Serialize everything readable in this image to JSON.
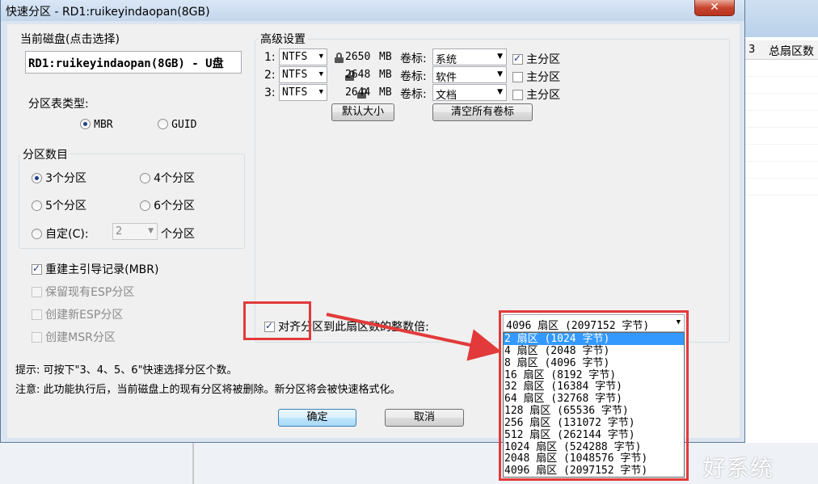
{
  "background_app": {
    "column_number": "3",
    "column_total_sectors": "总扇区数"
  },
  "dialog": {
    "title": "快速分区 - RD1:ruikeyindaopan(8GB)",
    "close_symbol": "✕",
    "current_disk": {
      "label": "当前磁盘(点击选择)",
      "value": "RD1:ruikeyindaopan(8GB) - U盘"
    },
    "partition_table": {
      "label": "分区表类型:",
      "options": [
        "MBR",
        "GUID"
      ],
      "selected": "MBR"
    },
    "partition_count": {
      "label": "分区数目",
      "options": [
        "3个分区",
        "4个分区",
        "5个分区",
        "6个分区"
      ],
      "custom_label": "自定(C):",
      "custom_value": "2",
      "custom_unit": "个分区",
      "selected": "3个分区"
    },
    "options": {
      "rebuild_mbr": "重建主引导记录(MBR)",
      "keep_esp": "保留现有ESP分区",
      "create_esp": "创建新ESP分区",
      "create_msr": "创建MSR分区"
    },
    "advanced": {
      "label": "高级设置",
      "rows": [
        {
          "index": "1:",
          "fs": "NTFS",
          "size": "2650",
          "unit": "MB",
          "vol_label": "卷标:",
          "vol": "系统",
          "primary": "主分区",
          "primary_checked": true,
          "locked": true
        },
        {
          "index": "2:",
          "fs": "NTFS",
          "size": "2648",
          "unit": "MB",
          "vol_label": "卷标:",
          "vol": "软件",
          "primary": "主分区",
          "primary_checked": false,
          "locked": false
        },
        {
          "index": "3:",
          "fs": "NTFS",
          "size": "2644",
          "unit": "MB",
          "vol_label": "卷标:",
          "vol": "文档",
          "primary": "主分区",
          "primary_checked": false,
          "locked": false
        }
      ],
      "default_size_button": "默认大小",
      "clear_labels_button": "清空所有卷标",
      "align_label": "对齐分区到此扇区数的整数倍:",
      "align_value": "4096 扇区 (2097152 字节)",
      "align_options": [
        "2 扇区 (1024 字节)",
        "4 扇区 (2048 字节)",
        "8 扇区 (4096 字节)",
        "16 扇区 (8192 字节)",
        "32 扇区 (16384 字节)",
        "64 扇区 (32768 字节)",
        "128 扇区 (65536 字节)",
        "256 扇区 (131072 字节)",
        "512 扇区 (262144 字节)",
        "1024 扇区 (524288 字节)",
        "2048 扇区 (1048576 字节)",
        "4096 扇区 (2097152 字节)"
      ],
      "align_highlighted": "2 扇区 (1024 字节)"
    },
    "hint": "提示: 可按下\"3、4、5、6\"快速选择分区个数。",
    "note": "注意: 此功能执行后，当前磁盘上的现有分区将被删除。新分区将会被快速格式化。",
    "ok_button": "确定",
    "cancel_button": "取消"
  },
  "colors": {
    "annotation_red": "#e23a3a",
    "selection_blue": "#3399ff"
  },
  "watermark": "好系统"
}
